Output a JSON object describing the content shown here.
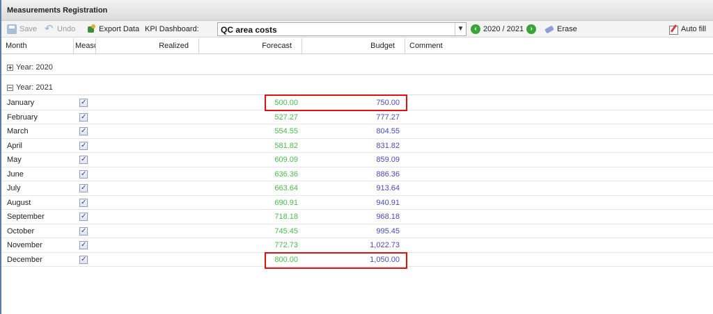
{
  "window": {
    "title": "Measurements Registration"
  },
  "toolbar": {
    "save_label": "Save",
    "undo_label": "Undo",
    "export_label": "Export Data",
    "kpi_label": "KPI Dashboard:",
    "kpi_value": "QC area costs",
    "period_label": "2020 / 2021",
    "erase_label": "Erase",
    "autofill_label": "Auto fill"
  },
  "columns": {
    "month": "Month",
    "measured": "Measu",
    "realized": "Realized",
    "forecast": "Forecast",
    "budget": "Budget",
    "comment": "Comment"
  },
  "groups": {
    "year2020": "Year: 2020",
    "year2021": "Year: 2021"
  },
  "rows": [
    {
      "month": "January",
      "measured": true,
      "forecast": "500.00",
      "budget": "750.00"
    },
    {
      "month": "February",
      "measured": true,
      "forecast": "527.27",
      "budget": "777.27"
    },
    {
      "month": "March",
      "measured": true,
      "forecast": "554.55",
      "budget": "804.55"
    },
    {
      "month": "April",
      "measured": true,
      "forecast": "581.82",
      "budget": "831.82"
    },
    {
      "month": "May",
      "measured": true,
      "forecast": "609.09",
      "budget": "859.09"
    },
    {
      "month": "June",
      "measured": true,
      "forecast": "636.36",
      "budget": "886.36"
    },
    {
      "month": "July",
      "measured": true,
      "forecast": "663.64",
      "budget": "913.64"
    },
    {
      "month": "August",
      "measured": true,
      "forecast": "690.91",
      "budget": "940.91"
    },
    {
      "month": "September",
      "measured": true,
      "forecast": "718.18",
      "budget": "968.18"
    },
    {
      "month": "October",
      "measured": true,
      "forecast": "745.45",
      "budget": "995.45"
    },
    {
      "month": "November",
      "measured": true,
      "forecast": "772.73",
      "budget": "1,022.73"
    },
    {
      "month": "December",
      "measured": true,
      "forecast": "800.00",
      "budget": "1,050.00"
    }
  ],
  "colors": {
    "forecast": "#4cbb4c",
    "budget": "#4a4ab8",
    "highlight": "#e01010",
    "window_border": "#5a7ea8"
  }
}
